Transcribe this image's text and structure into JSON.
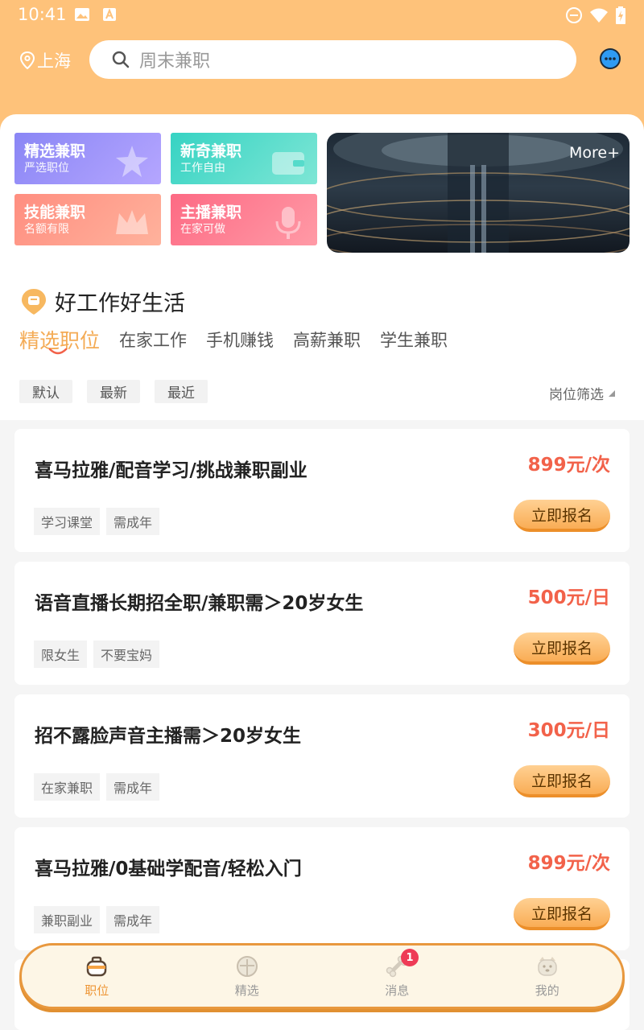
{
  "status_bar": {
    "time": "10:41"
  },
  "header": {
    "location": "上海",
    "search_placeholder": "周末兼职"
  },
  "categories": [
    {
      "title": "精选兼职",
      "subtitle": "严选职位",
      "color": "#8a86f5"
    },
    {
      "title": "新奇兼职",
      "subtitle": "工作自由",
      "color": "#36d3c3"
    },
    {
      "title": "技能兼职",
      "subtitle": "名额有限",
      "color": "#ff8e80"
    },
    {
      "title": "主播兼职",
      "subtitle": "在家可做",
      "color": "#fd6a84"
    }
  ],
  "banner": {
    "more_label": "More+"
  },
  "section": {
    "title": "好工作好生活",
    "tabs": [
      "精选职位",
      "在家工作",
      "手机赚钱",
      "高薪兼职",
      "学生兼职"
    ],
    "active_tab": "精选职位",
    "filters": [
      "默认",
      "最新",
      "最近"
    ],
    "post_filter_label": "岗位筛选"
  },
  "jobs": [
    {
      "title": "喜马拉雅/配音学习/挑战兼职副业",
      "price": "899元/次",
      "tags": [
        "学习课堂",
        "需成年"
      ],
      "apply_label": "立即报名"
    },
    {
      "title": "语音直播长期招全职/兼职需＞20岁女生",
      "price": "500元/日",
      "tags": [
        "限女生",
        "不要宝妈"
      ],
      "apply_label": "立即报名"
    },
    {
      "title": "招不露脸声音主播需＞20岁女生",
      "price": "300元/日",
      "tags": [
        "在家兼职",
        "需成年"
      ],
      "apply_label": "立即报名"
    },
    {
      "title": "喜马拉雅/0基础学配音/轻松入门",
      "price": "899元/次",
      "tags": [
        "兼职副业",
        "需成年"
      ],
      "apply_label": "立即报名"
    }
  ],
  "tabbar": {
    "items": [
      {
        "label": "职位",
        "icon": "briefcase-icon",
        "active": true
      },
      {
        "label": "精选",
        "icon": "lamp-icon",
        "active": false
      },
      {
        "label": "消息",
        "icon": "bone-icon",
        "active": false,
        "badge": "1"
      },
      {
        "label": "我的",
        "icon": "dog-face-icon",
        "active": false
      }
    ]
  },
  "colors": {
    "accent": "#fec27a",
    "price": "#f2624a",
    "active_tab": "#f4ab55",
    "badge": "#ee3b56"
  }
}
